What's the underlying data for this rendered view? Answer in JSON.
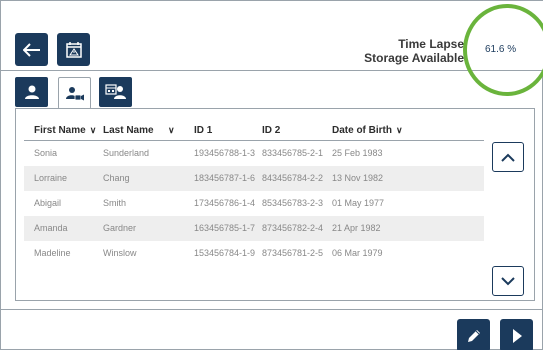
{
  "header": {
    "storage_label_line1": "Time Lapse",
    "storage_label_line2": "Storage Available",
    "storage_value": "61.6 %"
  },
  "icons": {
    "back": "back-arrow-icon",
    "calendar": "calendar-alert-icon",
    "tab_person": "person-icon",
    "tab_person_camera": "person-camera-icon",
    "tab_group_calendar": "group-calendar-icon",
    "edit": "pencil-icon",
    "next": "play-next-icon"
  },
  "colors": {
    "primary": "#1b3a5c",
    "ring": "#6ab43c",
    "row_alt": "#eeeeee"
  },
  "table": {
    "columns": [
      "First Name",
      "Last Name",
      "ID 1",
      "ID 2",
      "Date of Birth"
    ],
    "rows": [
      [
        "Sonia",
        "Sunderland",
        "193456788-1-3",
        "833456785-2-1",
        "25 Feb 1983"
      ],
      [
        "Lorraine",
        "Chang",
        "183456787-1-6",
        "843456784-2-2",
        "13 Nov 1982"
      ],
      [
        "Abigail",
        "Smith",
        "173456786-1-4",
        "853456783-2-3",
        "01 May 1977"
      ],
      [
        "Amanda",
        "Gardner",
        "163456785-1-7",
        "873456782-2-4",
        "21 Apr 1982"
      ],
      [
        "Madeline",
        "Winslow",
        "153456784-1-9",
        "873456781-2-5",
        "06 Mar 1979"
      ]
    ]
  }
}
